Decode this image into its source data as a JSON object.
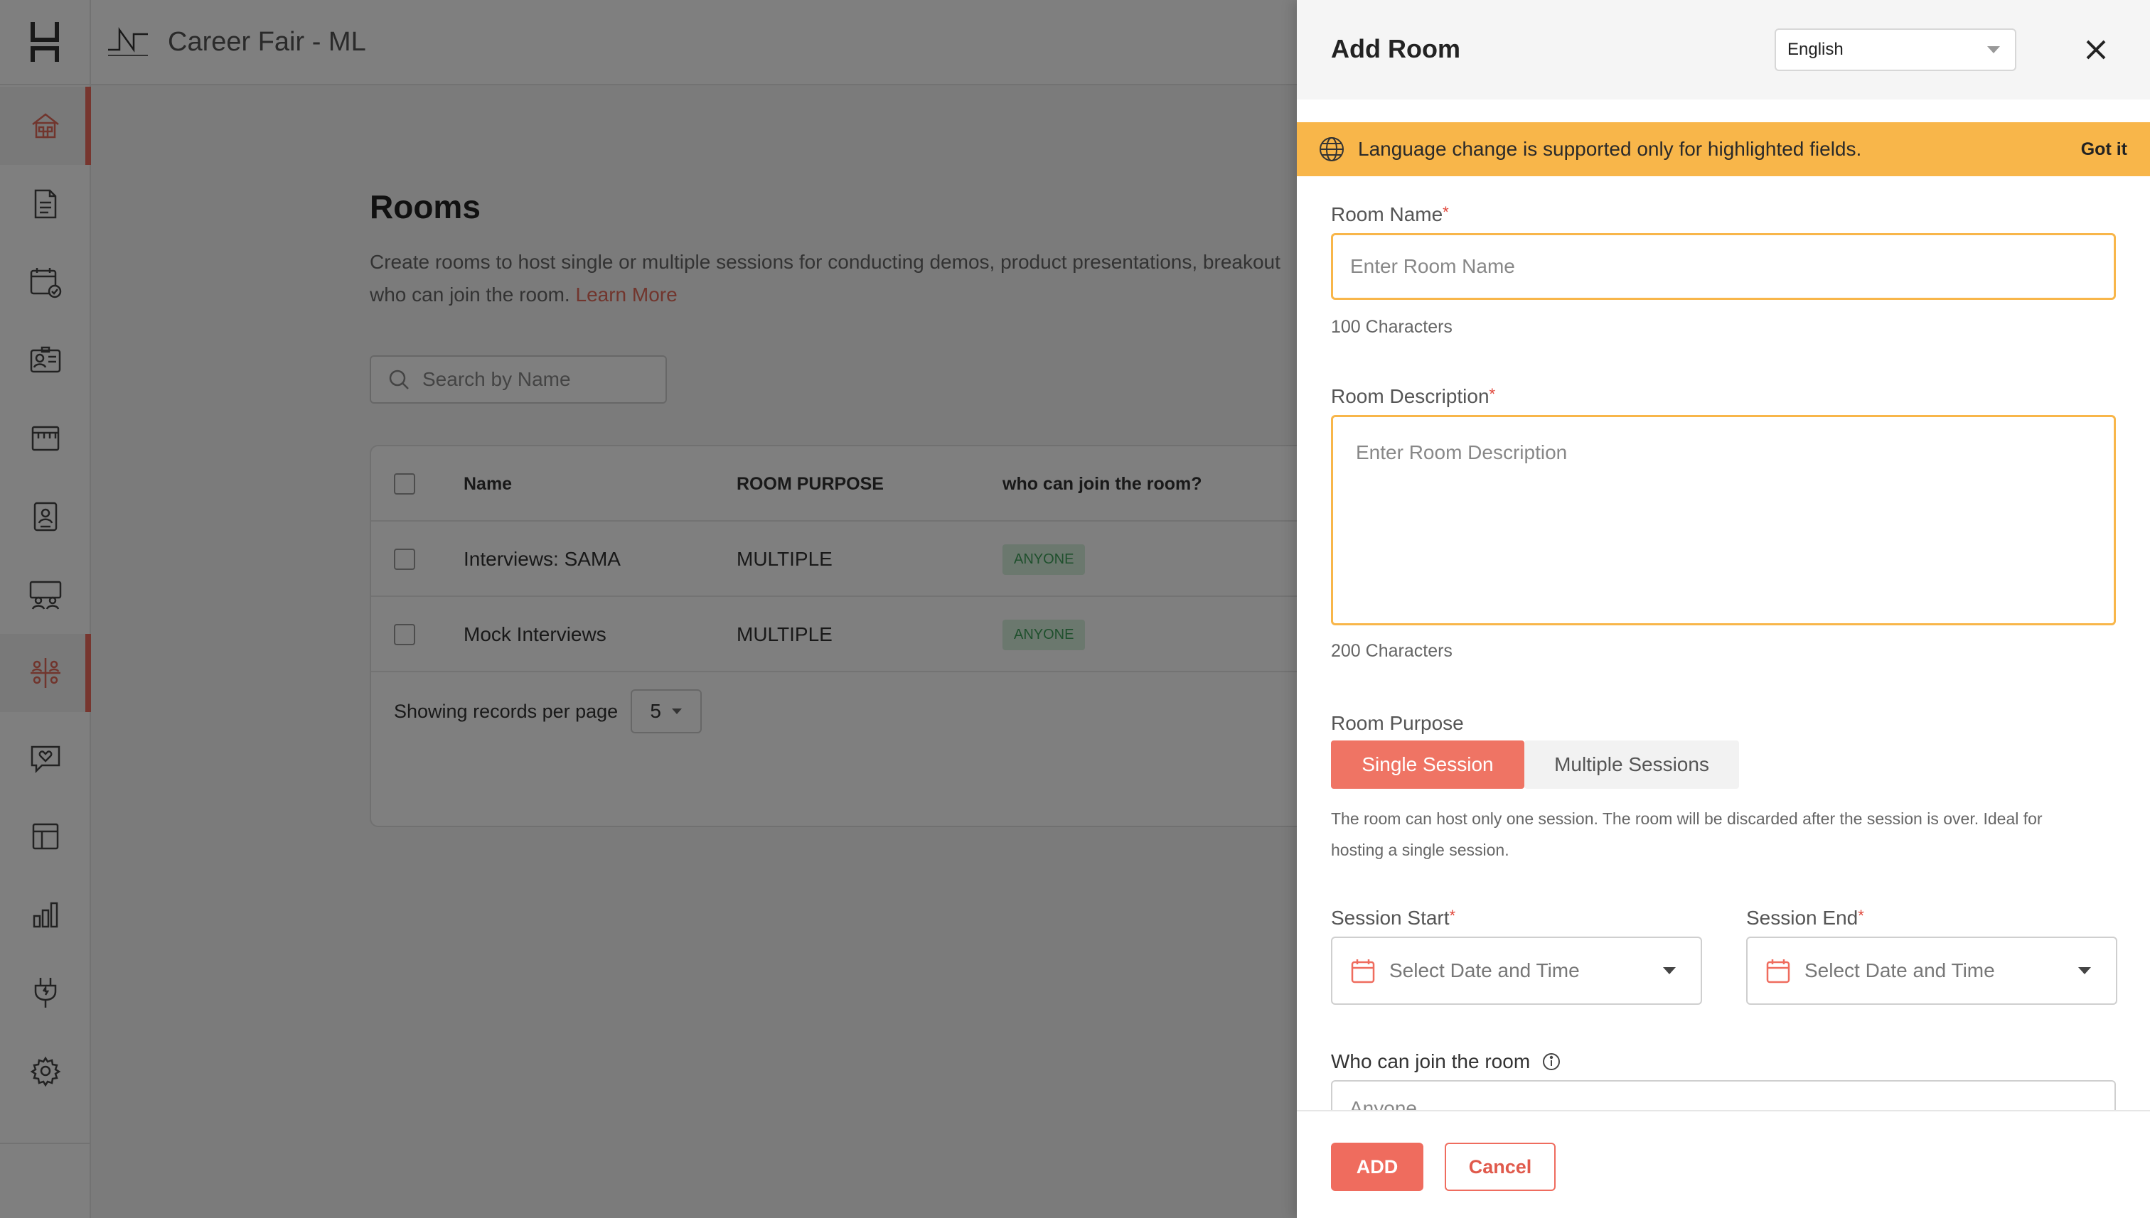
{
  "app": {
    "event_title": "Career Fair - ML",
    "accent_color": "#ef6c5e"
  },
  "sidebar": {
    "items": [
      {
        "icon": "home-icon"
      },
      {
        "icon": "document-icon"
      },
      {
        "icon": "calendar-check-icon"
      },
      {
        "icon": "id-card-icon"
      },
      {
        "icon": "booth-icon"
      },
      {
        "icon": "badge-icon"
      },
      {
        "icon": "lounge-icon"
      },
      {
        "icon": "rooms-icon",
        "active": true
      },
      {
        "icon": "chat-heart-icon"
      },
      {
        "icon": "layout-icon"
      },
      {
        "icon": "analytics-icon"
      },
      {
        "icon": "integrations-plug-icon"
      },
      {
        "icon": "settings-gear-icon"
      }
    ]
  },
  "rooms_page": {
    "title": "Rooms",
    "description": "Create rooms to host single or multiple sessions for conducting demos, product presentations, breakout",
    "description_line2": "who can join the room.",
    "learn_more": "Learn More",
    "search_placeholder": "Search by Name",
    "columns": [
      "Name",
      "ROOM PURPOSE",
      "who can join the room?"
    ],
    "rows": [
      {
        "name": "Interviews: SAMA",
        "purpose": "MULTIPLE",
        "access": "ANYONE"
      },
      {
        "name": "Mock Interviews",
        "purpose": "MULTIPLE",
        "access": "ANYONE"
      }
    ],
    "records_label": "Showing records per page",
    "per_page": "5"
  },
  "drawer": {
    "title": "Add Room",
    "language": "English",
    "banner_text": "Language change is supported only for highlighted fields.",
    "banner_action": "Got it",
    "room_name": {
      "label": "Room Name",
      "required": "*",
      "placeholder": "Enter Room Name",
      "limit": "100 Characters"
    },
    "room_description": {
      "label": "Room Description",
      "required": "*",
      "placeholder": "Enter Room Description",
      "limit": "200 Characters"
    },
    "room_purpose": {
      "label": "Room Purpose",
      "options": [
        "Single Session",
        "Multiple Sessions"
      ],
      "selected": "Single Session",
      "help_line1": "The room can host only one session. The room will be discarded after the session is over. Ideal for",
      "help_line2": "hosting a single session."
    },
    "session_start": {
      "label": "Session Start",
      "required": "*",
      "placeholder": "Select Date and Time"
    },
    "session_end": {
      "label": "Session End",
      "required": "*",
      "placeholder": "Select Date and Time"
    },
    "who_can_join": {
      "label": "Who can join the room",
      "value": "Anyone"
    },
    "add_button": "ADD",
    "cancel_button": "Cancel"
  }
}
